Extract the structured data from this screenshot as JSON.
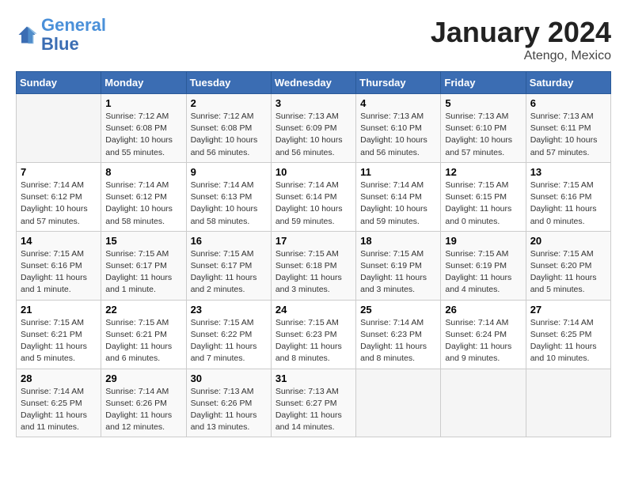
{
  "logo": {
    "line1": "General",
    "line2": "Blue"
  },
  "title": "January 2024",
  "subtitle": "Atengo, Mexico",
  "days_of_week": [
    "Sunday",
    "Monday",
    "Tuesday",
    "Wednesday",
    "Thursday",
    "Friday",
    "Saturday"
  ],
  "weeks": [
    [
      {
        "day": "",
        "info": ""
      },
      {
        "day": "1",
        "info": "Sunrise: 7:12 AM\nSunset: 6:08 PM\nDaylight: 10 hours\nand 55 minutes."
      },
      {
        "day": "2",
        "info": "Sunrise: 7:12 AM\nSunset: 6:08 PM\nDaylight: 10 hours\nand 56 minutes."
      },
      {
        "day": "3",
        "info": "Sunrise: 7:13 AM\nSunset: 6:09 PM\nDaylight: 10 hours\nand 56 minutes."
      },
      {
        "day": "4",
        "info": "Sunrise: 7:13 AM\nSunset: 6:10 PM\nDaylight: 10 hours\nand 56 minutes."
      },
      {
        "day": "5",
        "info": "Sunrise: 7:13 AM\nSunset: 6:10 PM\nDaylight: 10 hours\nand 57 minutes."
      },
      {
        "day": "6",
        "info": "Sunrise: 7:13 AM\nSunset: 6:11 PM\nDaylight: 10 hours\nand 57 minutes."
      }
    ],
    [
      {
        "day": "7",
        "info": "Sunrise: 7:14 AM\nSunset: 6:12 PM\nDaylight: 10 hours\nand 57 minutes."
      },
      {
        "day": "8",
        "info": "Sunrise: 7:14 AM\nSunset: 6:12 PM\nDaylight: 10 hours\nand 58 minutes."
      },
      {
        "day": "9",
        "info": "Sunrise: 7:14 AM\nSunset: 6:13 PM\nDaylight: 10 hours\nand 58 minutes."
      },
      {
        "day": "10",
        "info": "Sunrise: 7:14 AM\nSunset: 6:14 PM\nDaylight: 10 hours\nand 59 minutes."
      },
      {
        "day": "11",
        "info": "Sunrise: 7:14 AM\nSunset: 6:14 PM\nDaylight: 10 hours\nand 59 minutes."
      },
      {
        "day": "12",
        "info": "Sunrise: 7:15 AM\nSunset: 6:15 PM\nDaylight: 11 hours\nand 0 minutes."
      },
      {
        "day": "13",
        "info": "Sunrise: 7:15 AM\nSunset: 6:16 PM\nDaylight: 11 hours\nand 0 minutes."
      }
    ],
    [
      {
        "day": "14",
        "info": "Sunrise: 7:15 AM\nSunset: 6:16 PM\nDaylight: 11 hours\nand 1 minute."
      },
      {
        "day": "15",
        "info": "Sunrise: 7:15 AM\nSunset: 6:17 PM\nDaylight: 11 hours\nand 1 minute."
      },
      {
        "day": "16",
        "info": "Sunrise: 7:15 AM\nSunset: 6:17 PM\nDaylight: 11 hours\nand 2 minutes."
      },
      {
        "day": "17",
        "info": "Sunrise: 7:15 AM\nSunset: 6:18 PM\nDaylight: 11 hours\nand 3 minutes."
      },
      {
        "day": "18",
        "info": "Sunrise: 7:15 AM\nSunset: 6:19 PM\nDaylight: 11 hours\nand 3 minutes."
      },
      {
        "day": "19",
        "info": "Sunrise: 7:15 AM\nSunset: 6:19 PM\nDaylight: 11 hours\nand 4 minutes."
      },
      {
        "day": "20",
        "info": "Sunrise: 7:15 AM\nSunset: 6:20 PM\nDaylight: 11 hours\nand 5 minutes."
      }
    ],
    [
      {
        "day": "21",
        "info": "Sunrise: 7:15 AM\nSunset: 6:21 PM\nDaylight: 11 hours\nand 5 minutes."
      },
      {
        "day": "22",
        "info": "Sunrise: 7:15 AM\nSunset: 6:21 PM\nDaylight: 11 hours\nand 6 minutes."
      },
      {
        "day": "23",
        "info": "Sunrise: 7:15 AM\nSunset: 6:22 PM\nDaylight: 11 hours\nand 7 minutes."
      },
      {
        "day": "24",
        "info": "Sunrise: 7:15 AM\nSunset: 6:23 PM\nDaylight: 11 hours\nand 8 minutes."
      },
      {
        "day": "25",
        "info": "Sunrise: 7:14 AM\nSunset: 6:23 PM\nDaylight: 11 hours\nand 8 minutes."
      },
      {
        "day": "26",
        "info": "Sunrise: 7:14 AM\nSunset: 6:24 PM\nDaylight: 11 hours\nand 9 minutes."
      },
      {
        "day": "27",
        "info": "Sunrise: 7:14 AM\nSunset: 6:25 PM\nDaylight: 11 hours\nand 10 minutes."
      }
    ],
    [
      {
        "day": "28",
        "info": "Sunrise: 7:14 AM\nSunset: 6:25 PM\nDaylight: 11 hours\nand 11 minutes."
      },
      {
        "day": "29",
        "info": "Sunrise: 7:14 AM\nSunset: 6:26 PM\nDaylight: 11 hours\nand 12 minutes."
      },
      {
        "day": "30",
        "info": "Sunrise: 7:13 AM\nSunset: 6:26 PM\nDaylight: 11 hours\nand 13 minutes."
      },
      {
        "day": "31",
        "info": "Sunrise: 7:13 AM\nSunset: 6:27 PM\nDaylight: 11 hours\nand 14 minutes."
      },
      {
        "day": "",
        "info": ""
      },
      {
        "day": "",
        "info": ""
      },
      {
        "day": "",
        "info": ""
      }
    ]
  ]
}
